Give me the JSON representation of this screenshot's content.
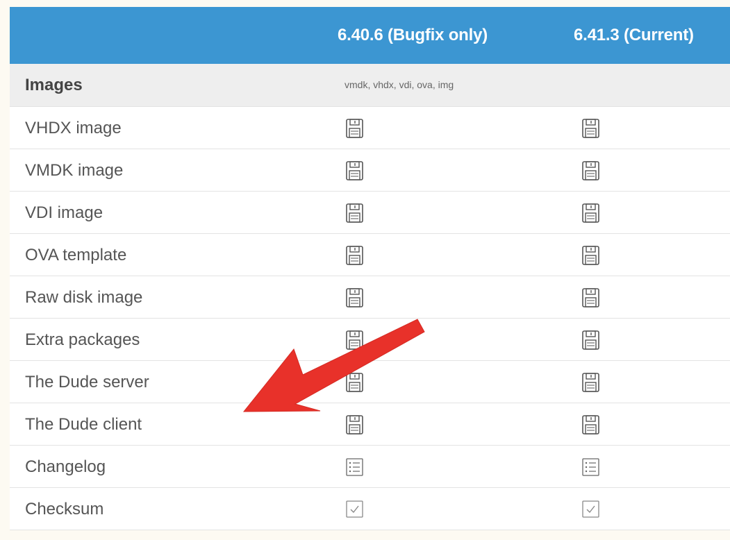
{
  "header": {
    "col1": "6.40.6 (Bugfix only)",
    "col2": "6.41.3 (Current)"
  },
  "section": {
    "label": "Images",
    "note": "vmdk, vhdx, vdi, ova, img"
  },
  "rows": [
    {
      "label": "VHDX image",
      "icon": "floppy-disk-icon"
    },
    {
      "label": "VMDK image",
      "icon": "floppy-disk-icon"
    },
    {
      "label": "VDI image",
      "icon": "floppy-disk-icon"
    },
    {
      "label": "OVA template",
      "icon": "floppy-disk-icon"
    },
    {
      "label": "Raw disk image",
      "icon": "floppy-disk-icon"
    },
    {
      "label": "Extra packages",
      "icon": "floppy-disk-icon"
    },
    {
      "label": "The Dude server",
      "icon": "floppy-disk-icon"
    },
    {
      "label": "The Dude client",
      "icon": "floppy-disk-icon"
    },
    {
      "label": "Changelog",
      "icon": "list-icon"
    },
    {
      "label": "Checksum",
      "icon": "checkbox-icon"
    }
  ],
  "colors": {
    "header_bg": "#3c96d2",
    "section_bg": "#eeeeee",
    "arrow": "#e8312a"
  }
}
